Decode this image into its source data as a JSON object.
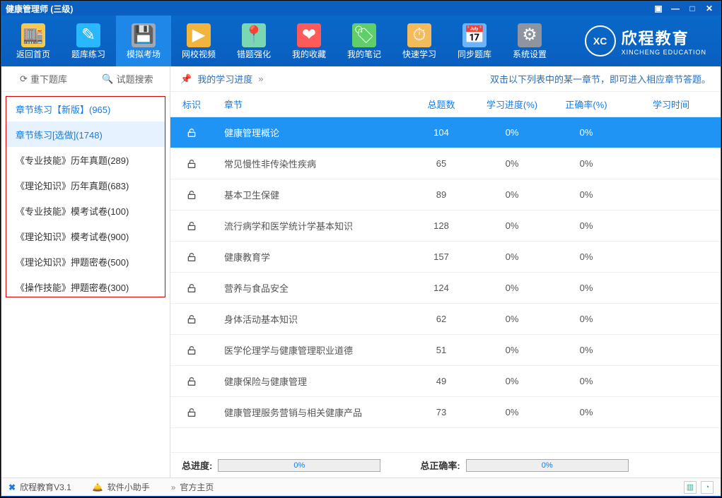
{
  "window": {
    "title": "健康管理师 (三级)"
  },
  "toolbar": {
    "items": [
      {
        "label": "返回首页",
        "icon": "home-icon"
      },
      {
        "label": "题库练习",
        "icon": "library-icon"
      },
      {
        "label": "模拟考场",
        "icon": "exam-icon"
      },
      {
        "label": "网校视频",
        "icon": "video-icon"
      },
      {
        "label": "错题强化",
        "icon": "wrong-icon"
      },
      {
        "label": "我的收藏",
        "icon": "favorite-icon"
      },
      {
        "label": "我的笔记",
        "icon": "note-icon"
      },
      {
        "label": "快速学习",
        "icon": "fast-icon"
      },
      {
        "label": "同步题库",
        "icon": "sync-icon"
      },
      {
        "label": "系统设置",
        "icon": "settings-icon"
      }
    ],
    "active_index": 2
  },
  "brand": {
    "short": "XC",
    "cn": "欣程教育",
    "en": "XINCHENG EDUCATION"
  },
  "sidebar": {
    "refresh": "重下题库",
    "search": "试题搜索",
    "items": [
      "章节练习【新版】(965)",
      "章节练习[选做](1748)",
      "《专业技能》历年真题(289)",
      "《理论知识》历年真题(683)",
      "《专业技能》模考试卷(100)",
      "《理论知识》模考试卷(900)",
      "《理论知识》押题密卷(500)",
      "《操作技能》押题密卷(300)"
    ],
    "selected_index": 1
  },
  "main": {
    "progress_label": "我的学习进度",
    "hint": "双击以下列表中的某一章节，即可进入相应章节答题。",
    "columns": {
      "flag": "标识",
      "chapter": "章节",
      "total": "总题数",
      "progress": "学习进度(%)",
      "accuracy": "正确率(%)",
      "time": "学习时间"
    },
    "rows": [
      {
        "chapter": "健康管理概论",
        "total": 104,
        "progress": "0%",
        "accuracy": "0%"
      },
      {
        "chapter": "常见慢性非传染性疾病",
        "total": 65,
        "progress": "0%",
        "accuracy": "0%"
      },
      {
        "chapter": "基本卫生保健",
        "total": 89,
        "progress": "0%",
        "accuracy": "0%"
      },
      {
        "chapter": "流行病学和医学统计学基本知识",
        "total": 128,
        "progress": "0%",
        "accuracy": "0%"
      },
      {
        "chapter": "健康教育学",
        "total": 157,
        "progress": "0%",
        "accuracy": "0%"
      },
      {
        "chapter": "营养与食品安全",
        "total": 124,
        "progress": "0%",
        "accuracy": "0%"
      },
      {
        "chapter": "身体活动基本知识",
        "total": 62,
        "progress": "0%",
        "accuracy": "0%"
      },
      {
        "chapter": "医学伦理学与健康管理职业道德",
        "total": 51,
        "progress": "0%",
        "accuracy": "0%"
      },
      {
        "chapter": "健康保险与健康管理",
        "total": 49,
        "progress": "0%",
        "accuracy": "0%"
      },
      {
        "chapter": "健康管理服务营销与相关健康产品",
        "total": 73,
        "progress": "0%",
        "accuracy": "0%"
      }
    ],
    "active_row": 0
  },
  "summary": {
    "total_progress_label": "总进度:",
    "total_progress": "0%",
    "total_accuracy_label": "总正确率:",
    "total_accuracy": "0%"
  },
  "status": {
    "app": "欣程教育V3.1",
    "helper": "软件小助手",
    "home": "官方主页"
  }
}
